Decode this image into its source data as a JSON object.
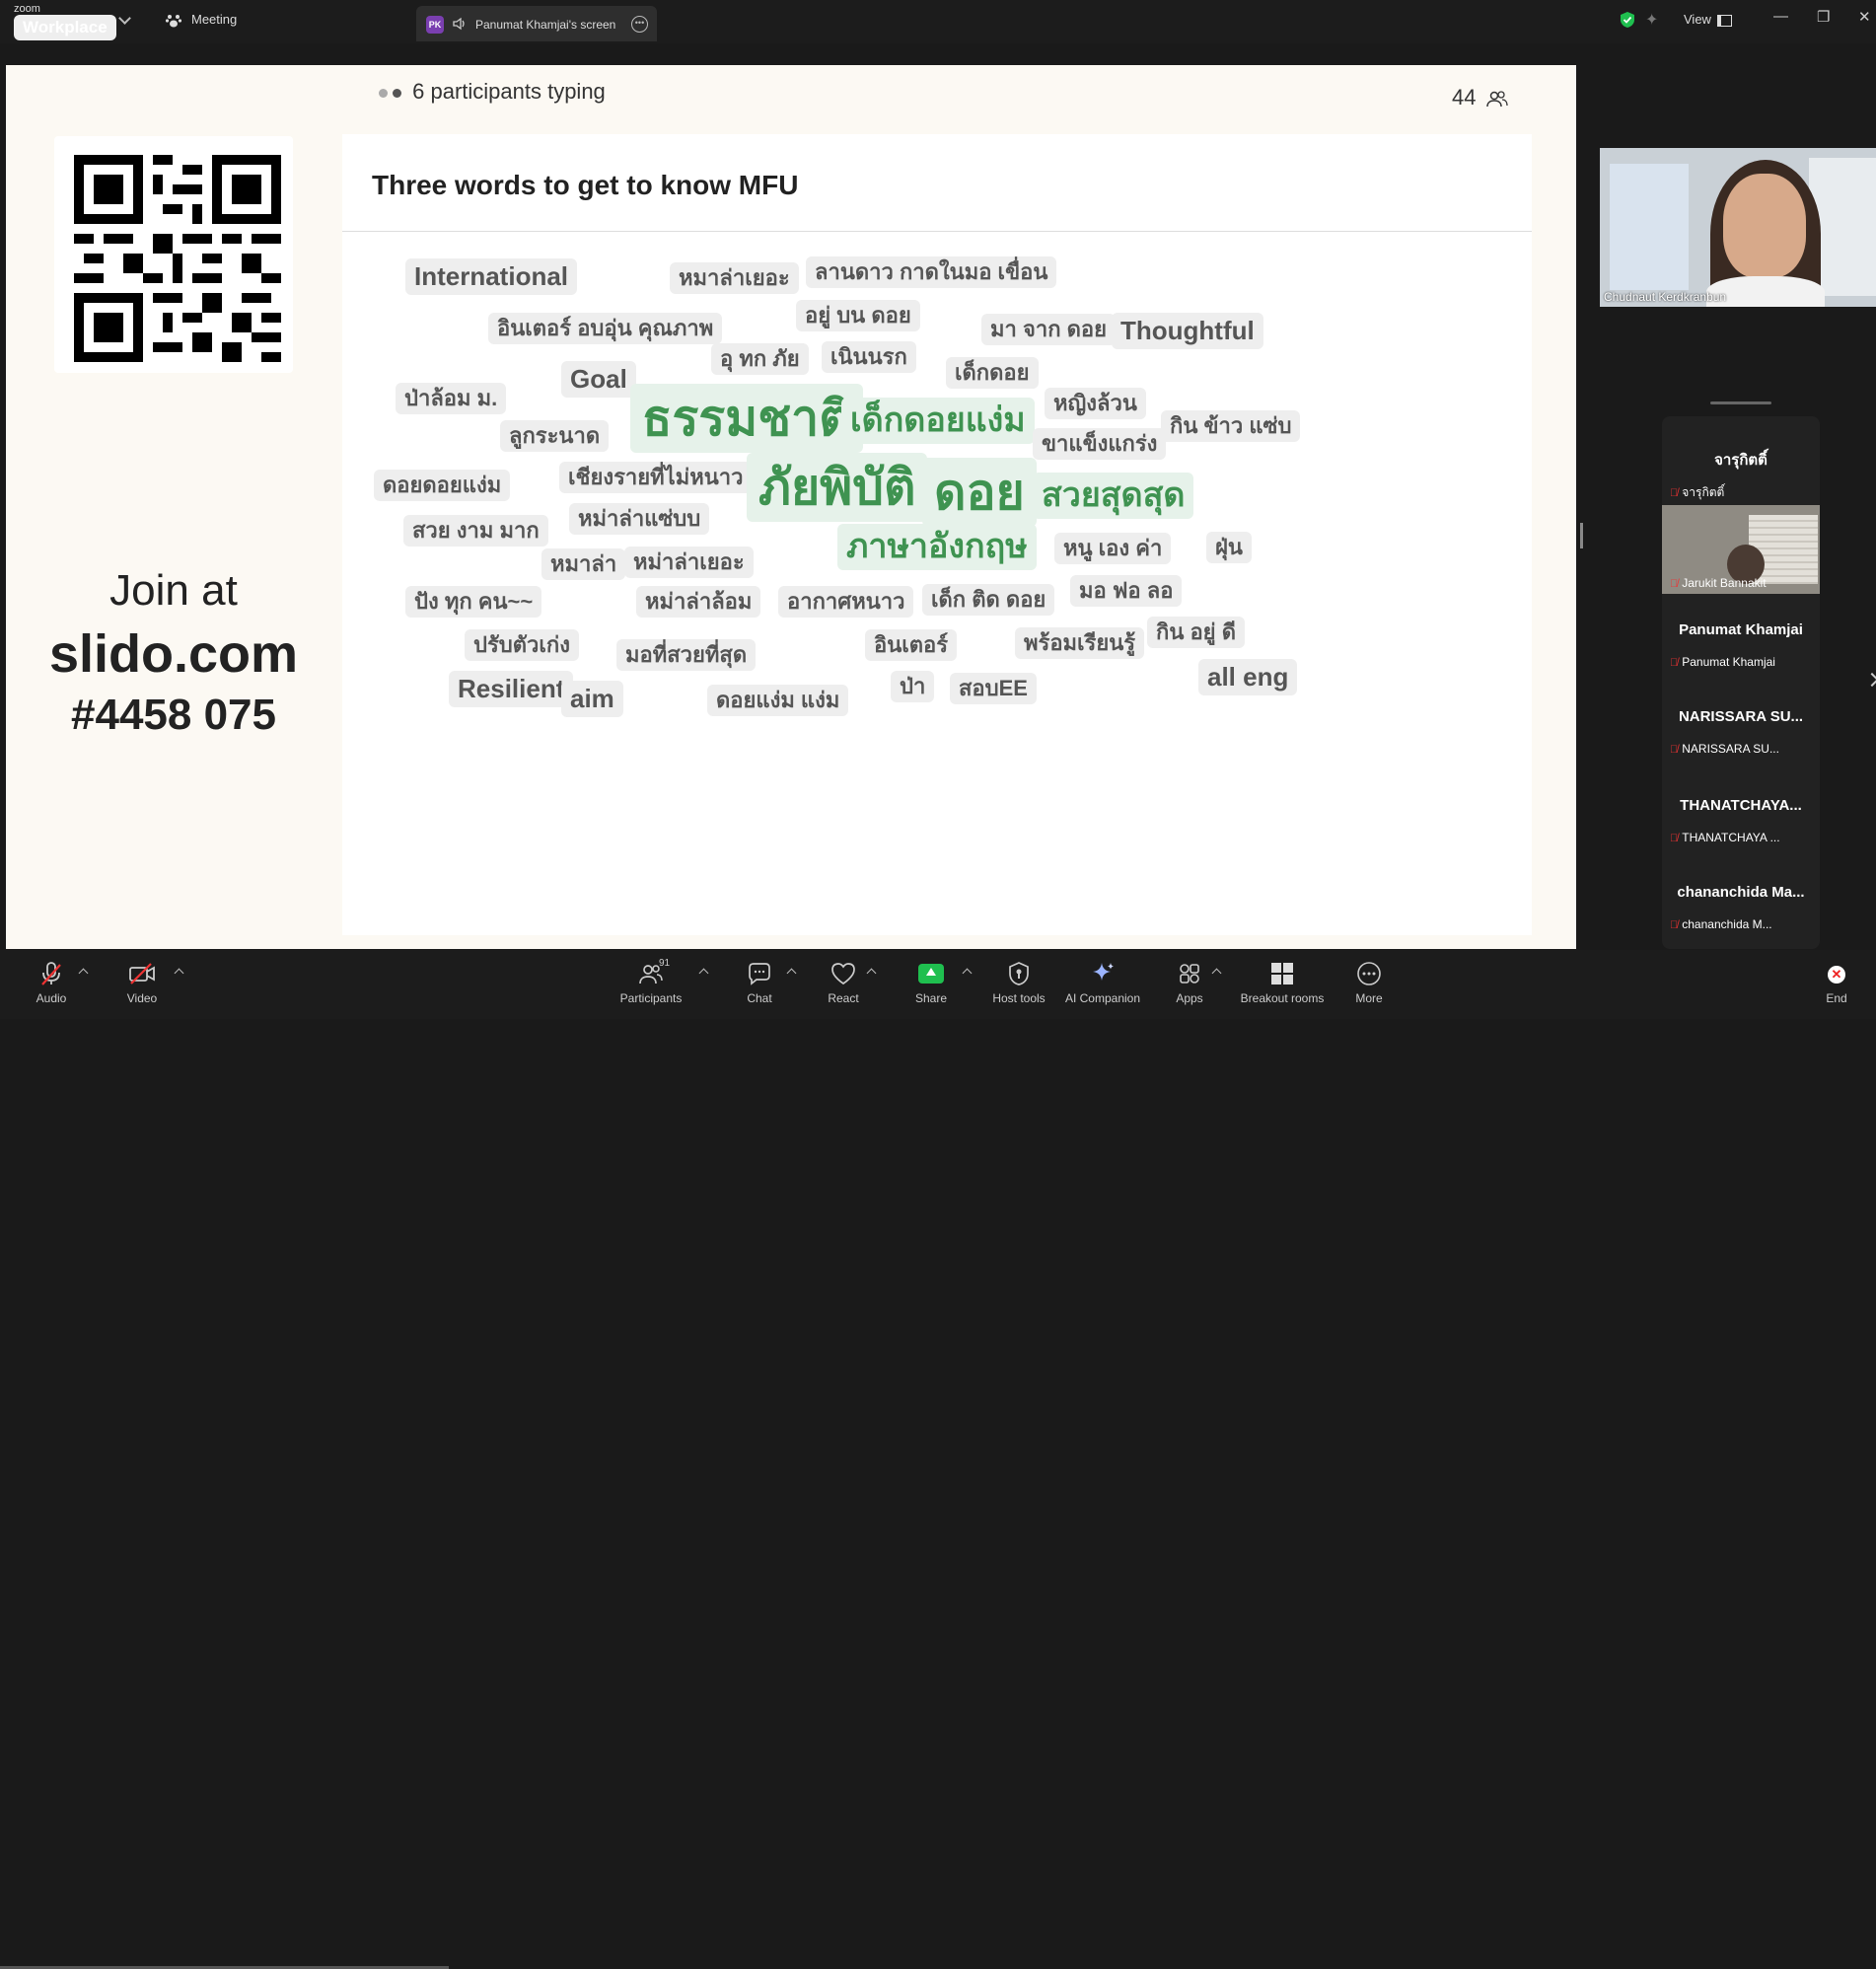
{
  "topbar": {
    "brand_small": "zoom",
    "brand_main": "Workplace",
    "meeting_tab": "Meeting",
    "screen_tab_initials": "PK",
    "screen_tab_label": "Panumat Khamjai's screen",
    "view_label": "View"
  },
  "slide": {
    "typing_status": "6 participants typing",
    "participant_count": "44",
    "join_line1": "Join at",
    "join_line2": "slido.com",
    "join_line3": "#4458 075",
    "title": "Three words to get to know MFU",
    "words": [
      {
        "text": "International",
        "size": "m"
      },
      {
        "text": "หมาล่าเยอะ",
        "size": "s"
      },
      {
        "text": "ลานดาว กาดในมอ เขื่อน",
        "size": "s"
      },
      {
        "text": "อินเตอร์ อบอุ่น คุณภาพ",
        "size": "s"
      },
      {
        "text": "อยู่ บน ดอย",
        "size": "s"
      },
      {
        "text": "มา จาก ดอย",
        "size": "s"
      },
      {
        "text": "Thoughtful",
        "size": "m"
      },
      {
        "text": "อุ ทก ภัย",
        "size": "s"
      },
      {
        "text": "เนินนรก",
        "size": "s"
      },
      {
        "text": "Goal",
        "size": "m"
      },
      {
        "text": "เด็กดอย",
        "size": "s"
      },
      {
        "text": "ป่าล้อม ม.",
        "size": "s"
      },
      {
        "text": "ธรรมชาติ",
        "size": "gl"
      },
      {
        "text": "เด็กดอยแง่ม",
        "size": "g"
      },
      {
        "text": "หญิงล้วน",
        "size": "s"
      },
      {
        "text": "ลูกระนาด",
        "size": "s"
      },
      {
        "text": "ขาแข็งแกร่ง",
        "size": "s"
      },
      {
        "text": "กิน ข้าว แซ่บ",
        "size": "s"
      },
      {
        "text": "ดอยดอยแง่ม",
        "size": "s"
      },
      {
        "text": "เชียงรายที่ไม่หนาว",
        "size": "s"
      },
      {
        "text": "ภัยพิบัติ",
        "size": "gl"
      },
      {
        "text": "ดอย",
        "size": "gl"
      },
      {
        "text": "สวยสุดสุด",
        "size": "g"
      },
      {
        "text": "สวย งาม มาก",
        "size": "s"
      },
      {
        "text": "หม่าล่าแซ่บบ",
        "size": "s"
      },
      {
        "text": "ภาษาอังกฤษ",
        "size": "g"
      },
      {
        "text": "หนู เอง ค่า",
        "size": "s"
      },
      {
        "text": "ฝุ่น",
        "size": "s"
      },
      {
        "text": "หมาล่า",
        "size": "s"
      },
      {
        "text": "หม่าล่าเยอะ",
        "size": "s"
      },
      {
        "text": "ปัง ทุก คน~~",
        "size": "s"
      },
      {
        "text": "หม่าล่าล้อม",
        "size": "s"
      },
      {
        "text": "อากาศหนาว",
        "size": "s"
      },
      {
        "text": "เด็ก ติด ดอย",
        "size": "s"
      },
      {
        "text": "มอ ฟอ ลอ",
        "size": "s"
      },
      {
        "text": "ปรับตัวเก่ง",
        "size": "s"
      },
      {
        "text": "มอที่สวยที่สุด",
        "size": "s"
      },
      {
        "text": "อินเตอร์",
        "size": "s"
      },
      {
        "text": "พร้อมเรียนรู้",
        "size": "s"
      },
      {
        "text": "กิน อยู่ ดี",
        "size": "s"
      },
      {
        "text": "Resilient",
        "size": "m"
      },
      {
        "text": "aim",
        "size": "m"
      },
      {
        "text": "ดอยแง่ม แง่ม",
        "size": "s"
      },
      {
        "text": "ป่า",
        "size": "s"
      },
      {
        "text": "สอบEE",
        "size": "s"
      },
      {
        "text": "all eng",
        "size": "m"
      }
    ]
  },
  "speaker": {
    "name": "Chudnaut Kerdkranbun"
  },
  "participants": [
    {
      "display": "จารุกิตติ์",
      "name": "จารุกิตติ์"
    },
    {
      "display": "",
      "name": "Jarukit Bannakit"
    },
    {
      "display": "Panumat Khamjai",
      "name": "Panumat Khamjai"
    },
    {
      "display": "NARISSARA SU...",
      "name": "NARISSARA SU..."
    },
    {
      "display": "THANATCHAYA...",
      "name": "THANATCHAYA ..."
    },
    {
      "display": "chananchida  Ma...",
      "name": "chananchida M..."
    }
  ],
  "toolbar": {
    "audio": "Audio",
    "video": "Video",
    "participants": "Participants",
    "participants_count": "91",
    "chat": "Chat",
    "react": "React",
    "share": "Share",
    "host_tools": "Host tools",
    "ai_companion": "AI Companion",
    "apps": "Apps",
    "breakout_rooms": "Breakout rooms",
    "more": "More",
    "end": "End"
  }
}
